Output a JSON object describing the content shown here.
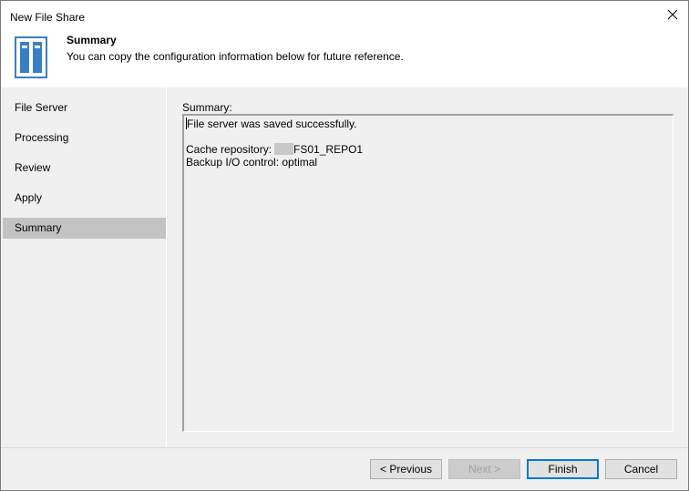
{
  "window": {
    "title": "New File Share"
  },
  "header": {
    "title": "Summary",
    "subtitle": "You can copy the configuration information below for future reference.",
    "icon": "file-share-icon"
  },
  "sidebar": {
    "items": [
      {
        "label": "File Server"
      },
      {
        "label": "Processing"
      },
      {
        "label": "Review"
      },
      {
        "label": "Apply"
      },
      {
        "label": "Summary",
        "active": true
      }
    ]
  },
  "summary": {
    "label": "Summary:",
    "lines": [
      "File server was saved successfully.",
      "",
      "FS01_REPO1",
      "Backup I/O control: optimal"
    ],
    "cache_label": "Cache repository:"
  },
  "footer": {
    "previous_label": "< Previous",
    "next_label": "Next >",
    "finish_label": "Finish",
    "cancel_label": "Cancel"
  },
  "colors": {
    "active_step_bg": "#c3c3c3",
    "panel_bg": "#f0f0f0",
    "default_button_border": "#0078d7"
  }
}
